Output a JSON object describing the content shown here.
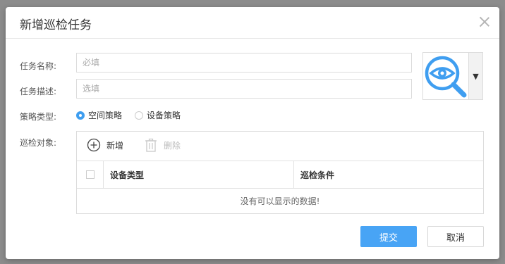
{
  "dialog": {
    "title": "新增巡检任务",
    "form": {
      "name": {
        "label": "任务名称:",
        "placeholder": "必填",
        "value": ""
      },
      "description": {
        "label": "任务描述:",
        "placeholder": "选填",
        "value": ""
      },
      "strategy": {
        "label": "策略类型:",
        "options": [
          {
            "label": "空间策略",
            "checked": true
          },
          {
            "label": "设备策略",
            "checked": false
          }
        ]
      },
      "targets": {
        "label": "巡检对象:",
        "toolbar": {
          "add_label": "新增",
          "delete_label": "删除"
        },
        "columns": [
          "设备类型",
          "巡检条件"
        ],
        "empty_text": "没有可以显示的数据!"
      }
    },
    "icon_select": {
      "icon": "eye-search-icon",
      "arrow": "▼",
      "color": "#3f9ef0"
    },
    "buttons": {
      "submit": "提交",
      "cancel": "取消"
    }
  },
  "colors": {
    "primary": "#48a4f5",
    "radio": "#3f9ef0",
    "overlay": "#8c8c8c"
  }
}
